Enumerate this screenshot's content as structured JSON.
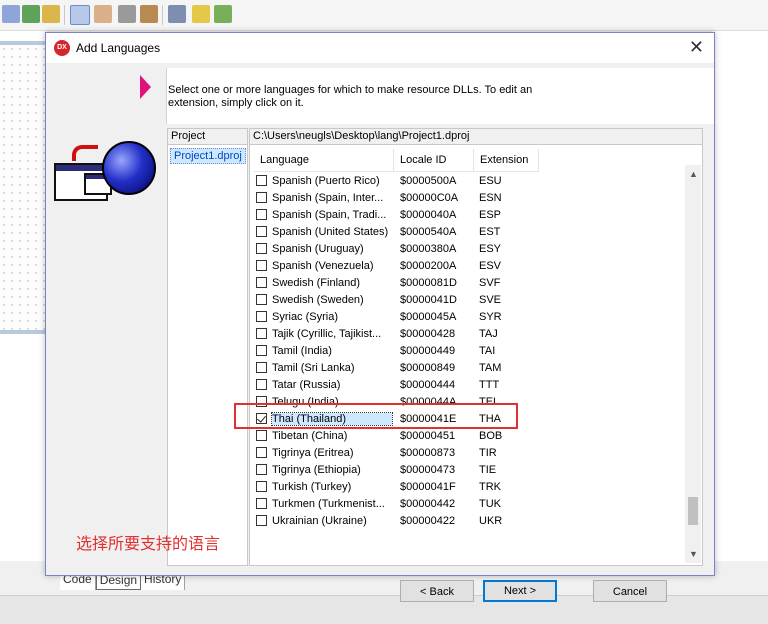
{
  "dialog": {
    "title": "Add Languages",
    "icon_text": "DX",
    "close_label": "✕",
    "instruction": "Select one or more languages for which to make resource DLLs. To edit an extension, simply click on it."
  },
  "project": {
    "header": "Project",
    "item": "Project1.dproj",
    "path": "C:\\Users\\neugls\\Desktop\\lang\\Project1.dproj"
  },
  "columns": {
    "language": "Language",
    "locale": "Locale ID",
    "extension": "Extension"
  },
  "rows": [
    {
      "lang": "Spanish (Puerto Rico)",
      "locale": "$0000500A",
      "ext": "ESU",
      "checked": false
    },
    {
      "lang": "Spanish (Spain, Inter...",
      "locale": "$00000C0A",
      "ext": "ESN",
      "checked": false
    },
    {
      "lang": "Spanish (Spain, Tradi...",
      "locale": "$0000040A",
      "ext": "ESP",
      "checked": false
    },
    {
      "lang": "Spanish (United States)",
      "locale": "$0000540A",
      "ext": "EST",
      "checked": false
    },
    {
      "lang": "Spanish (Uruguay)",
      "locale": "$0000380A",
      "ext": "ESY",
      "checked": false
    },
    {
      "lang": "Spanish (Venezuela)",
      "locale": "$0000200A",
      "ext": "ESV",
      "checked": false
    },
    {
      "lang": "Swedish (Finland)",
      "locale": "$0000081D",
      "ext": "SVF",
      "checked": false
    },
    {
      "lang": "Swedish (Sweden)",
      "locale": "$0000041D",
      "ext": "SVE",
      "checked": false
    },
    {
      "lang": "Syriac (Syria)",
      "locale": "$0000045A",
      "ext": "SYR",
      "checked": false
    },
    {
      "lang": "Tajik (Cyrillic, Tajikist...",
      "locale": "$00000428",
      "ext": "TAJ",
      "checked": false
    },
    {
      "lang": "Tamil (India)",
      "locale": "$00000449",
      "ext": "TAI",
      "checked": false
    },
    {
      "lang": "Tamil (Sri Lanka)",
      "locale": "$00000849",
      "ext": "TAM",
      "checked": false
    },
    {
      "lang": "Tatar (Russia)",
      "locale": "$00000444",
      "ext": "TTT",
      "checked": false
    },
    {
      "lang": "Telugu (India)",
      "locale": "$0000044A",
      "ext": "TEL",
      "checked": false
    },
    {
      "lang": "Thai (Thailand)",
      "locale": "$0000041E",
      "ext": "THA",
      "checked": true,
      "selected": true
    },
    {
      "lang": "Tibetan (China)",
      "locale": "$00000451",
      "ext": "BOB",
      "checked": false
    },
    {
      "lang": "Tigrinya (Eritrea)",
      "locale": "$00000873",
      "ext": "TIR",
      "checked": false
    },
    {
      "lang": "Tigrinya (Ethiopia)",
      "locale": "$00000473",
      "ext": "TIE",
      "checked": false
    },
    {
      "lang": "Turkish (Turkey)",
      "locale": "$0000041F",
      "ext": "TRK",
      "checked": false
    },
    {
      "lang": "Turkmen (Turkmenist...",
      "locale": "$00000442",
      "ext": "TUK",
      "checked": false
    },
    {
      "lang": "Ukrainian (Ukraine)",
      "locale": "$00000422",
      "ext": "UKR",
      "checked": false
    }
  ],
  "buttons": {
    "back": "< Back",
    "next": "Next >",
    "cancel": "Cancel"
  },
  "annotation": "选择所要支持的语言",
  "ide_tabs": [
    "Code",
    "Design",
    "History"
  ],
  "colors": {
    "highlight_red": "#e03030",
    "selection_blue": "#cde8ff",
    "accent_pink": "#e0127a",
    "dialog_border": "#7a82c8"
  }
}
